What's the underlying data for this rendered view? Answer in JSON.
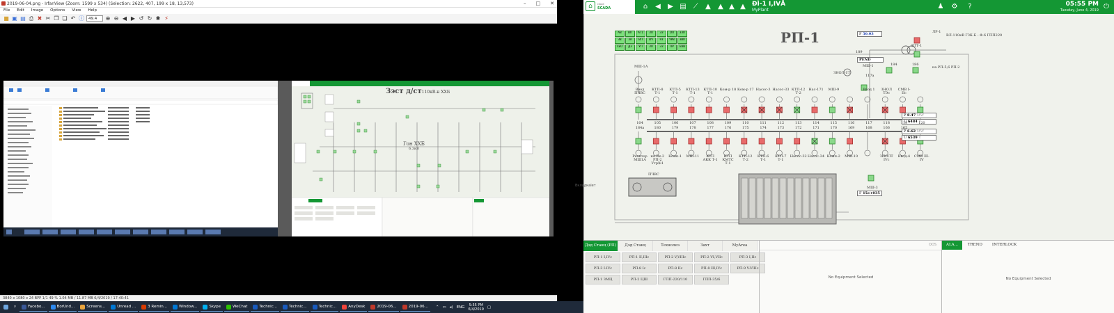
{
  "irfanview": {
    "title": "2019-06-04.png - IrfanView (Zoom: 1599 x 534) (Selection: 2622, 407, 199 x 18, 13,573)",
    "menu": [
      "File",
      "Edit",
      "Image",
      "Options",
      "View",
      "Help"
    ],
    "zoom_value": "49.4",
    "status": "3840 x 1080 x 24 BPP    1/1    49 %    1.04 MB / 11.87 MB    6/4/2019 / 17:40:41"
  },
  "taskbar": {
    "items": [
      {
        "label": "Facebo...",
        "color": "#3b5998"
      },
      {
        "label": "BorUnd...",
        "color": "#2d89ef"
      },
      {
        "label": "Screens...",
        "color": "#e8a33d"
      },
      {
        "label": "Unread ...",
        "color": "#0078d4"
      },
      {
        "label": "3 Remin...",
        "color": "#d83b01"
      },
      {
        "label": "Window...",
        "color": "#0078d4"
      },
      {
        "label": "Skype",
        "color": "#00aff0"
      },
      {
        "label": "WeChat",
        "color": "#2dc100"
      },
      {
        "label": "Technic...",
        "color": "#185abd"
      },
      {
        "label": "Technic...",
        "color": "#185abd"
      },
      {
        "label": "Technic...",
        "color": "#185abd"
      },
      {
        "label": "AnyDesk",
        "color": "#ef443b"
      },
      {
        "label": "2019-06...",
        "color": "#c0392b"
      },
      {
        "label": "2019-06...",
        "color": "#c0392b"
      }
    ],
    "lang": "ENG",
    "time": "5:55 PM",
    "date": "6/4/2019"
  },
  "embedded": {
    "scada_title": "Зэст д/ст",
    "scada_subtitle": "110кВ-н ХХБ",
    "subsection": "Гон ХХБ",
    "subsection_volt": "6.3кВ"
  },
  "scada": {
    "logo_line1": "cloud",
    "logo_line2": "SCADA",
    "station_id": "ĐÌ-1 І,ІVĂ",
    "station_name": "MyPlant",
    "time": "05:55 PM",
    "date": "Tuesday, June 4, 2019",
    "title": "РП-1",
    "freq_value": "50.03",
    "freq_label": "F",
    "status_chips": [
      "АВ",
      "ВП",
      "АТ1",
      "ЗП",
      "ЗЗ",
      "ОП",
      "ЗЗП",
      "ЗВ",
      "ЗА",
      "ВП",
      "ВЧ",
      "РЗ",
      "УРВ",
      "ЗВП"
    ],
    "status_chips_row2": [
      "СЕО",
      "ДЗ",
      "УП",
      "ЗП",
      "ЗЗ",
      "ПР",
      "ВЗВ"
    ],
    "top_right_lr": "ЛР-1",
    "top_right_line": "ВЛ-110кВ ГЗК-Б - Ф-6 ГПП220",
    "vtt": "ВТТ-1",
    "rp5": "на РП-5,6 РП-2",
    "p1_value": "8.47",
    "u1_value": "6484",
    "p2_value": "6.62",
    "u2_value": "6539",
    "f2_value": "15e+035",
    "unit_mw": "MW",
    "unit_v": "V",
    "upper_feeders": [
      "Ввод ПЧВС",
      "КТП-8 Т-1",
      "КТП-5 Т-1",
      "КТП-13 Т-1",
      "КТП-10 Т-1",
      "Ком-р 18",
      "Ком-р 17",
      "Насос-3",
      "Насос-33",
      "КТП-12 Т-2",
      "Нас-171",
      "МШ-9",
      "",
      "Ввод 1",
      "ЗНОЛ ТЭс",
      "СМВ I-IIс"
    ],
    "lower_feeders": [
      "Реактор МШ1А",
      "на Вк-2 РП-2 Утр№1",
      "Комп-1",
      "МШ-11",
      "КТП АКК Т-1",
      "КТП КМТС Т-1",
      "КТП-12 Т-2",
      "КТП-6 Т-1",
      "КТП-7 Т-1",
      "Насос-32",
      "Насос-34",
      "Комп-2",
      "МШ-10",
      "",
      "ЗНОЛТ IVс",
      "Ввод-4",
      "СМВ III-IV"
    ],
    "upper_nums": [
      "104",
      "105",
      "106",
      "107",
      "108",
      "109",
      "110",
      "111",
      "112",
      "113",
      "114",
      "115",
      "116",
      "117",
      "118",
      "119",
      "120"
    ],
    "lower_nums": [
      "184а",
      "180",
      "179",
      "178",
      "177",
      "176",
      "175",
      "174",
      "173",
      "172",
      "171",
      "170",
      "169",
      "168",
      "166",
      "165"
    ],
    "top_labels": {
      "m1a": "МШ-1А",
      "b189": "189",
      "b184": "184",
      "b186": "186",
      "pend": "PEND",
      "mshi": "МШ-1",
      "znol": "ЗНОЛ-1Т",
      "t117": "117а",
      "mshi3": "МШ-3",
      "pchvs": "ПЧВС"
    },
    "bottom_tabs": [
      "Дэд Станц (РП)",
      "Дэд Станц (ЦРП)",
      "Технолеэ",
      "Захт",
      "MyArea"
    ],
    "bottom_grid": [
      "РП-1 I,IVс",
      "РП-1 II,IIIс",
      "РП-2 V,VIIIс",
      "РП-2 VI,VIIс",
      "РП-3 I,IIс",
      "РП-3 I-IVс",
      "РП-8 Iс",
      "РП-8 IIс",
      "РП-8 III,IVс",
      "РП-9 V-VIIIс",
      "РП-1 ЗМЦ",
      "РП-2 ЦШ",
      "ГПП-220/110",
      "ГПП-35/6"
    ],
    "oos": "OOS",
    "no_equipment": "No Equipment Selected",
    "right_tabs": [
      "ALA...",
      "TREND",
      "INTERLOCK"
    ],
    "side_text": "Вкладкаlет"
  }
}
